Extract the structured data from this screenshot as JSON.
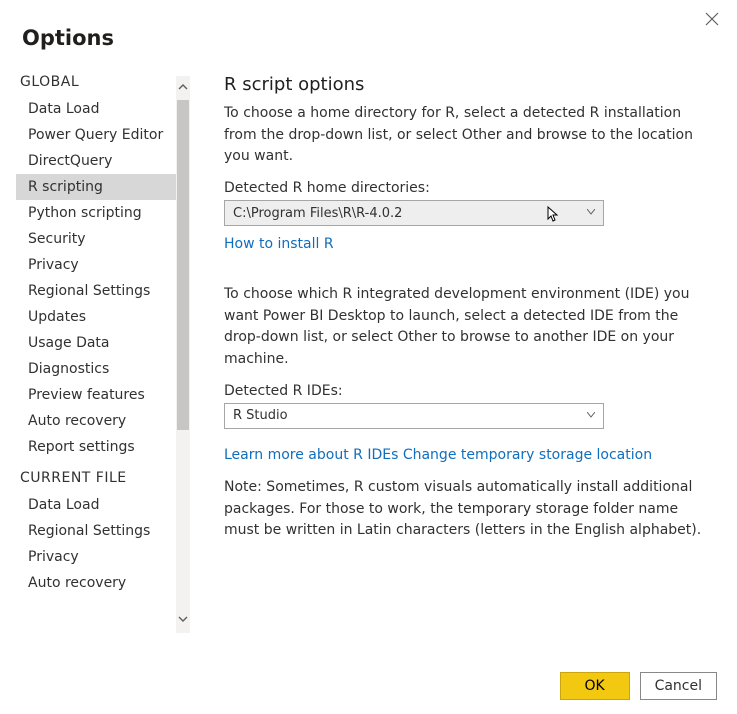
{
  "window": {
    "title": "Options"
  },
  "sidebar": {
    "sections": [
      {
        "header": "GLOBAL",
        "items": [
          "Data Load",
          "Power Query Editor",
          "DirectQuery",
          "R scripting",
          "Python scripting",
          "Security",
          "Privacy",
          "Regional Settings",
          "Updates",
          "Usage Data",
          "Diagnostics",
          "Preview features",
          "Auto recovery",
          "Report settings"
        ],
        "selectedIndex": 3
      },
      {
        "header": "CURRENT FILE",
        "items": [
          "Data Load",
          "Regional Settings",
          "Privacy",
          "Auto recovery"
        ]
      }
    ]
  },
  "content": {
    "heading": "R script options",
    "intro": "To choose a home directory for R, select a detected R installation from the drop-down list, or select Other and browse to the location you want.",
    "homeDirLabel": "Detected R home directories:",
    "homeDirValue": "C:\\Program Files\\R\\R-4.0.2",
    "howToInstallLink": "How to install R",
    "idePara": "To choose which R integrated development environment (IDE) you want Power BI Desktop to launch, select a detected IDE from the drop-down list, or select Other to browse to another IDE on your machine.",
    "ideLabel": "Detected R IDEs:",
    "ideValue": "R Studio",
    "learnMoreLink": "Learn more about R IDEs",
    "changeTempLink": "Change temporary storage location",
    "tempNote": "Note: Sometimes, R custom visuals automatically install additional packages. For those to work, the temporary storage folder name must be written in Latin characters (letters in the English alphabet)."
  },
  "footer": {
    "ok": "OK",
    "cancel": "Cancel"
  }
}
